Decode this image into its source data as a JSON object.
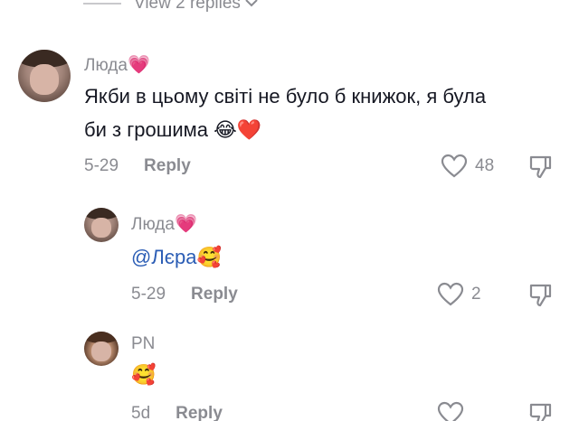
{
  "view_replies": {
    "label": "View 2 replies"
  },
  "comments": [
    {
      "username": "Люда",
      "username_emoji": "💗",
      "text_line1": "Якби в цьому світі не було б книжок, я була",
      "text_line2": "би з грошима",
      "text_emojis": "😂❤️",
      "date": "5-29",
      "reply_label": "Reply",
      "likes": "48"
    },
    {
      "username": "Люда",
      "username_emoji": "💗",
      "mention": "@Лєра",
      "text_emojis": "🥰",
      "date": "5-29",
      "reply_label": "Reply",
      "likes": "2"
    },
    {
      "username": "PN",
      "text_emojis": "🥰",
      "date": "5d",
      "reply_label": "Reply"
    }
  ],
  "colors": {
    "muted": "#8a8b91",
    "text": "#161823",
    "mention": "#2b5db5"
  }
}
